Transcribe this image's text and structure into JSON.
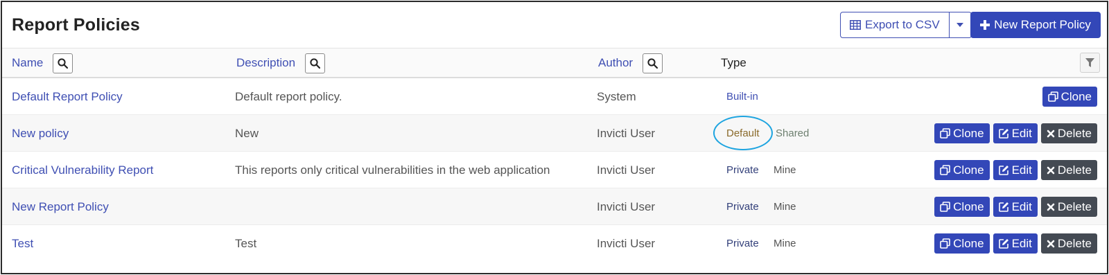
{
  "header": {
    "title": "Report Policies",
    "export_label": "Export to CSV",
    "new_policy_label": "New Report Policy"
  },
  "columns": {
    "name": "Name",
    "description": "Description",
    "author": "Author",
    "type": "Type"
  },
  "rows": [
    {
      "name": "Default Report Policy",
      "description": "Default report policy.",
      "author": "System",
      "tag1": "Built-in",
      "tag2": "",
      "actions": [
        "Clone"
      ]
    },
    {
      "name": "New policy",
      "description": "New",
      "author": "Invicti User",
      "tag1": "Default",
      "tag2": "Shared",
      "actions": [
        "Clone",
        "Edit",
        "Delete"
      ]
    },
    {
      "name": "Critical Vulnerability Report",
      "description": "This reports only critical vulnerabilities in the web application",
      "author": "Invicti User",
      "tag1": "Private",
      "tag2": "Mine",
      "actions": [
        "Clone",
        "Edit",
        "Delete"
      ]
    },
    {
      "name": "New Report Policy",
      "description": "",
      "author": "Invicti User",
      "tag1": "Private",
      "tag2": "Mine",
      "actions": [
        "Clone",
        "Edit",
        "Delete"
      ]
    },
    {
      "name": "Test",
      "description": "Test",
      "author": "Invicti User",
      "tag1": "Private",
      "tag2": "Mine",
      "actions": [
        "Clone",
        "Edit",
        "Delete"
      ]
    }
  ],
  "icons": {
    "export": "table-icon",
    "caret": "caret-down-icon",
    "new": "plus-icon",
    "search": "search-icon",
    "filter": "filter-icon",
    "clone": "clone-icon",
    "edit": "edit-icon",
    "delete": "close-icon"
  },
  "colors": {
    "accent": "#3347b8",
    "link": "#3f4fb3",
    "dark_button": "#444a53",
    "highlight_ring": "#1da4e0"
  }
}
